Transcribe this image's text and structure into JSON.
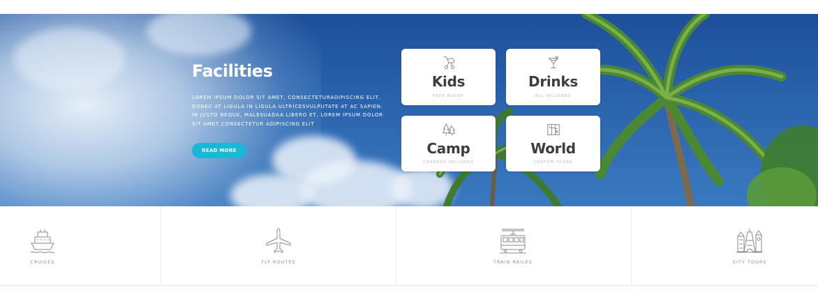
{
  "hero": {
    "title": "Facilities",
    "description": "LOREM IPSUM DOLOR SIT AMET, CONSECTETURADIPISCING ELIT. DONEC AT LIGULA IN LIGULA ULTRICESVULPUTATE AT AC SAPIEN. IN JUSTO NEQUE, MALESUADAA LIBERO ET, LOREM IPSUM DOLOR SIT AMET,CONSECTETUR ADIPISCING ELIT",
    "button_label": "READ MORE",
    "button_color": "#19b8d8"
  },
  "cards": [
    {
      "title": "Kids",
      "subtitle": "FREE BUGGY",
      "icon": "stroller-icon"
    },
    {
      "title": "Drinks",
      "subtitle": "ALL INCLUDED",
      "icon": "cocktail-icon"
    },
    {
      "title": "Camp",
      "subtitle": "CAROVAN INCLUDED",
      "icon": "trees-icon"
    },
    {
      "title": "World",
      "subtitle": "CUSTOM TOURS",
      "icon": "map-icon"
    }
  ],
  "services": [
    {
      "label": "CRUISES",
      "icon": "ship-icon"
    },
    {
      "label": "FLY ROUTES",
      "icon": "airplane-icon"
    },
    {
      "label": "TRAIN RAILES",
      "icon": "train-icon"
    },
    {
      "label": "CITY TOURS",
      "icon": "landmarks-icon"
    }
  ]
}
